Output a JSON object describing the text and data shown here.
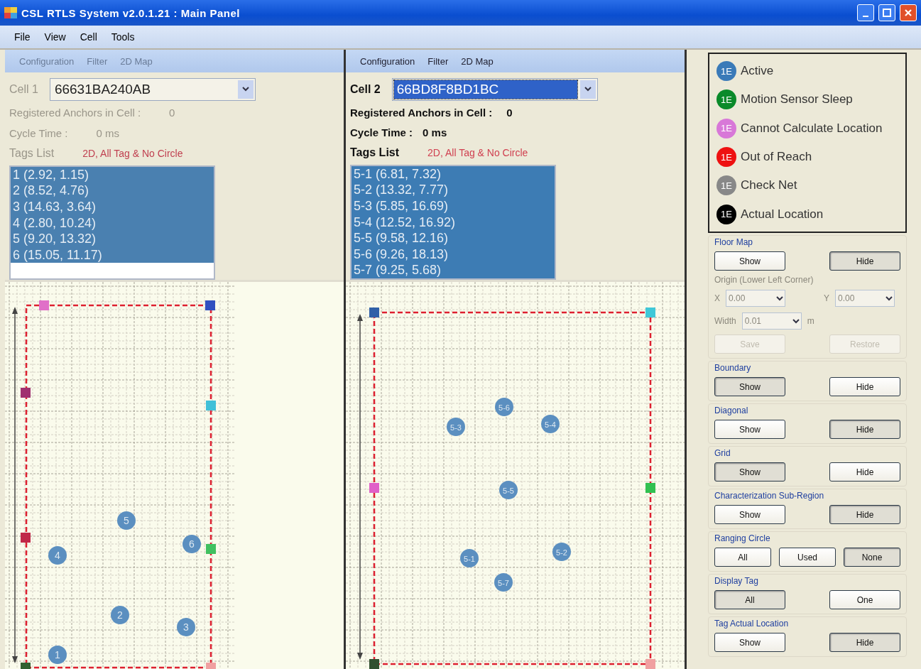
{
  "window": {
    "title": "CSL RTLS System v2.0.1.21 : Main Panel"
  },
  "menu": [
    "File",
    "View",
    "Cell",
    "Tools"
  ],
  "cells": [
    {
      "disabled": true,
      "tabs": [
        "Configuration",
        "Filter",
        "2D Map"
      ],
      "cell_label": "Cell 1",
      "cell_value": "66631BA240AB",
      "highlighted": false,
      "anchors_label": "Registered Anchors in Cell :",
      "anchors_value": "0",
      "cycle_label": "Cycle Time :",
      "cycle_value": "0 ms",
      "tags_label": "Tags List",
      "mode": "2D, All Tag & No Circle",
      "tags": [
        {
          "text": "1 (2.92, 1.15)",
          "selected": true
        },
        {
          "text": "2 (8.52, 4.76)",
          "selected": true
        },
        {
          "text": "3 (14.63, 3.64)",
          "selected": true
        },
        {
          "text": "4 (2.80, 10.24)",
          "selected": true
        },
        {
          "text": "5 (9.20, 13.32)",
          "selected": true
        },
        {
          "text": "6 (15.05, 11.17)",
          "selected": true
        }
      ],
      "map": {
        "markers": [
          "1",
          "2",
          "3",
          "4",
          "5",
          "6"
        ],
        "anchors": [
          {
            "color": "#e070c8"
          },
          {
            "color": "#3050c0"
          },
          {
            "color": "#a03070"
          },
          {
            "color": "#40c0d8"
          },
          {
            "color": "#c02848"
          },
          {
            "color": "#40c060"
          },
          {
            "color": "#306030"
          },
          {
            "color": "#f0a0a0"
          }
        ]
      }
    },
    {
      "disabled": false,
      "tabs": [
        "Configuration",
        "Filter",
        "2D Map"
      ],
      "cell_label": "Cell 2",
      "cell_value": "66BD8F8BD1BC",
      "highlighted": true,
      "anchors_label": "Registered Anchors in Cell :",
      "anchors_value": "0",
      "cycle_label": "Cycle Time :",
      "cycle_value": "0 ms",
      "tags_label": "Tags List",
      "mode": "2D, All Tag & No Circle",
      "tags": [
        {
          "text": "5-1 (6.81, 7.32)",
          "selected": true
        },
        {
          "text": "5-2 (13.32, 7.77)",
          "selected": true
        },
        {
          "text": "5-3 (5.85, 16.69)",
          "selected": true
        },
        {
          "text": "5-4 (12.52, 16.92)",
          "selected": true
        },
        {
          "text": "5-5 (9.58, 12.16)",
          "selected": true
        },
        {
          "text": "5-6 (9.26, 18.13)",
          "selected": true
        },
        {
          "text": "5-7 (9.25, 5.68)",
          "selected": true
        }
      ],
      "map": {
        "markers": [
          "5-1",
          "5-2",
          "5-3",
          "5-4",
          "5-5",
          "5-6",
          "5-7"
        ],
        "anchors": [
          {
            "color": "#3060a8"
          },
          {
            "color": "#40c8d8"
          },
          {
            "color": "#e060c8"
          },
          {
            "color": "#30c050"
          },
          {
            "color": "#305030"
          },
          {
            "color": "#f0a0a0"
          }
        ]
      }
    }
  ],
  "legend": [
    {
      "badge": "1E",
      "label": "Active",
      "color": "#3a7ab8"
    },
    {
      "badge": "1E",
      "label": "Motion Sensor Sleep",
      "color": "#0a8a2a"
    },
    {
      "badge": "1E",
      "label": "Cannot Calculate Location",
      "color": "#d878d8"
    },
    {
      "badge": "1E",
      "label": "Out of Reach",
      "color": "#ee1111"
    },
    {
      "badge": "1E",
      "label": "Check Net",
      "color": "#888888"
    },
    {
      "badge": "1E",
      "label": "Actual Location",
      "color": "#000000"
    }
  ],
  "groups": [
    {
      "kind": "floor",
      "title": "Floor Map",
      "buttons": [
        {
          "label": "Show",
          "selected": false
        },
        {
          "label": "Hide",
          "selected": true
        }
      ],
      "origin": {
        "title": "Origin (Lower Left Corner)",
        "x_label": "X",
        "x_value": "0.00",
        "y_label": "Y",
        "y_value": "0.00",
        "width_label": "Width",
        "width_value": "0.01",
        "unit": "m",
        "disabled": true
      },
      "actions": [
        {
          "label": "Save",
          "disabled": true
        },
        {
          "label": "Restore",
          "disabled": true
        }
      ]
    },
    {
      "kind": "toggle",
      "title": "Boundary",
      "buttons": [
        {
          "label": "Show",
          "selected": true
        },
        {
          "label": "Hide",
          "selected": false
        }
      ]
    },
    {
      "kind": "toggle",
      "title": "Diagonal",
      "buttons": [
        {
          "label": "Show",
          "selected": false
        },
        {
          "label": "Hide",
          "selected": true
        }
      ]
    },
    {
      "kind": "toggle",
      "title": "Grid",
      "buttons": [
        {
          "label": "Show",
          "selected": true
        },
        {
          "label": "Hide",
          "selected": false
        }
      ]
    },
    {
      "kind": "toggle",
      "title": "Characterization Sub-Region",
      "buttons": [
        {
          "label": "Show",
          "selected": false
        },
        {
          "label": "Hide",
          "selected": true
        }
      ]
    },
    {
      "kind": "toggle",
      "title": "Ranging Circle",
      "buttons": [
        {
          "label": "All",
          "selected": false
        },
        {
          "label": "Used",
          "selected": false
        },
        {
          "label": "None",
          "selected": true
        }
      ]
    },
    {
      "kind": "toggle",
      "title": "Display Tag",
      "buttons": [
        {
          "label": "All",
          "selected": true
        },
        {
          "label": "One",
          "selected": false
        }
      ]
    },
    {
      "kind": "toggle",
      "title": "Tag Actual Location",
      "buttons": [
        {
          "label": "Show",
          "selected": false
        },
        {
          "label": "Hide",
          "selected": true
        }
      ]
    }
  ]
}
